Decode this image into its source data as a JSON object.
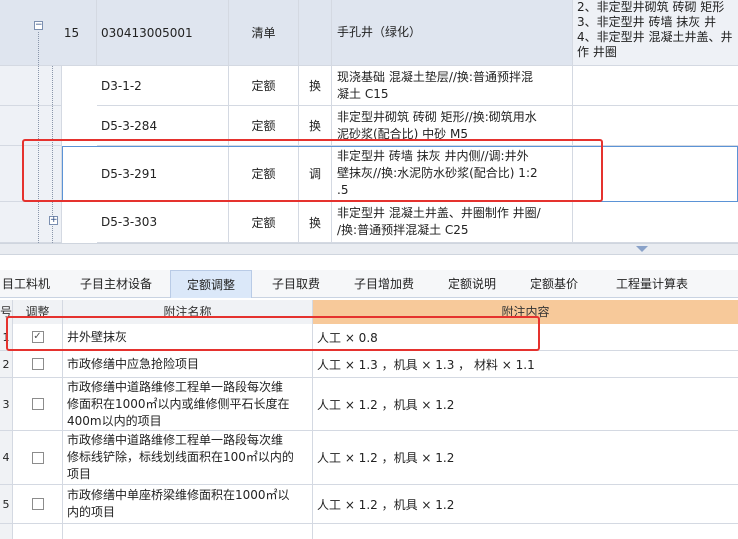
{
  "upper_rows": [
    {
      "num": "15",
      "code": "030413005001",
      "type": "清单",
      "flag": "",
      "name": "手孔井（绿化）",
      "features": "2、非定型井砌筑 砖砌 矩形\n3、非定型井 砖墙 抹灰 井\n4、非定型井 混凝土井盖、井\n作 井圈"
    },
    {
      "num": "",
      "code": "D3-1-2",
      "type": "定额",
      "flag": "换",
      "name": "现浇基础 混凝土垫层//换:普通预拌混\n凝土 C15",
      "features": ""
    },
    {
      "num": "",
      "code": "D5-3-284",
      "type": "定额",
      "flag": "换",
      "name": "非定型井砌筑 砖砌 矩形//换:砌筑用水\n泥砂浆(配合比) 中砂 M5",
      "features": ""
    },
    {
      "num": "",
      "code": "D5-3-291",
      "type": "定额",
      "flag": "调",
      "name": "非定型井 砖墙 抹灰 井内侧//调:井外\n壁抹灰//换:水泥防水砂浆(配合比) 1:2\n.5",
      "features": ""
    },
    {
      "num": "",
      "code": "D5-3-303",
      "type": "定额",
      "flag": "换",
      "name": "非定型井 混凝土井盖、井圈制作 井圈/\n/换:普通预拌混凝土 C25",
      "features": ""
    }
  ],
  "tabs": [
    "目工料机",
    "子目主材设备",
    "定额调整",
    "子目取费",
    "子目增加费",
    "定额说明",
    "定额基价",
    "工程量计算表"
  ],
  "active_tab": "定额调整",
  "lower_header": {
    "idx": "号",
    "adjust": "调整",
    "name": "附注名称",
    "content": "附注内容"
  },
  "lower_rows": [
    {
      "idx": "1",
      "checked": true,
      "check_mark": "✓",
      "name": "井外壁抹灰",
      "content": "人工 × 0.8"
    },
    {
      "idx": "2",
      "checked": false,
      "check_mark": "",
      "name": "市政修缮中应急抢险项目",
      "content": "人工 × 1.3 ，机具 × 1.3 ， 材料 × 1.1"
    },
    {
      "idx": "3",
      "checked": false,
      "check_mark": "",
      "name": "市政修缮中道路维修工程单一路段每次维\n修面积在1000㎡以内或维修侧平石长度在\n400m以内的项目",
      "content": "人工 × 1.2 ，机具 × 1.2"
    },
    {
      "idx": "4",
      "checked": false,
      "check_mark": "",
      "name": "市政修缮中道路维修工程单一路段每次维\n修标线铲除，标线划线面积在100㎡以内的\n项目",
      "content": "人工 × 1.2 ，机具 × 1.2"
    },
    {
      "idx": "5",
      "checked": false,
      "check_mark": "",
      "name": "市政修缮中单座桥梁维修面积在1000㎡以\n内的项目",
      "content": "人工 × 1.2 ，机具 × 1.2"
    }
  ],
  "colors": {
    "highlight": "#e5322e",
    "active_tab_bg": "#dbe8f9",
    "content_header_bg": "#f7c99a",
    "selected_border": "#5b93d6"
  }
}
